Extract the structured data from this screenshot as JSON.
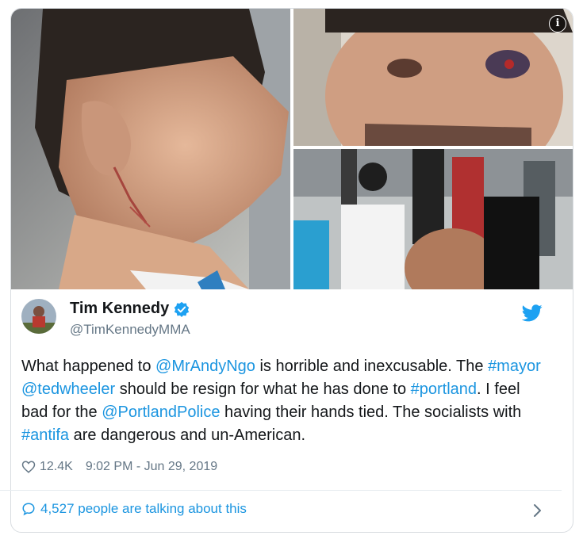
{
  "tweet": {
    "author_name": "Tim Kennedy",
    "author_handle": "@TimKennedyMMA",
    "text_parts": [
      {
        "t": "What happened to ",
        "link": false
      },
      {
        "t": "@MrAndyNgo",
        "link": true
      },
      {
        "t": " is horrible and inexcusable.  The ",
        "link": false
      },
      {
        "t": "#mayor",
        "link": true
      },
      {
        "t": " ",
        "link": false
      },
      {
        "t": "@tedwheeler",
        "link": true
      },
      {
        "t": " should be resign for what he has done to ",
        "link": false
      },
      {
        "t": "#portland",
        "link": true
      },
      {
        "t": ". I feel bad for the ",
        "link": false
      },
      {
        "t": "@PortlandPolice",
        "link": true
      },
      {
        "t": " having their hands tied. The socialists with ",
        "link": false
      },
      {
        "t": "#antifa",
        "link": true
      },
      {
        "t": " are dangerous and un-American.",
        "link": false
      }
    ],
    "likes": "12.4K",
    "timestamp": "9:02 PM - Jun 29, 2019",
    "talking_text": "4,527 people are talking about this"
  },
  "icons": {
    "info": "info-icon",
    "verified": "verified-badge-icon",
    "brand": "twitter-bird-icon",
    "like": "heart-icon",
    "reply": "speech-bubble-icon",
    "chevron": "chevron-right-icon"
  },
  "colors": {
    "link": "#1b95e0",
    "secondary_text": "#657786",
    "brand": "#1da1f2",
    "border": "#d9dde1"
  }
}
